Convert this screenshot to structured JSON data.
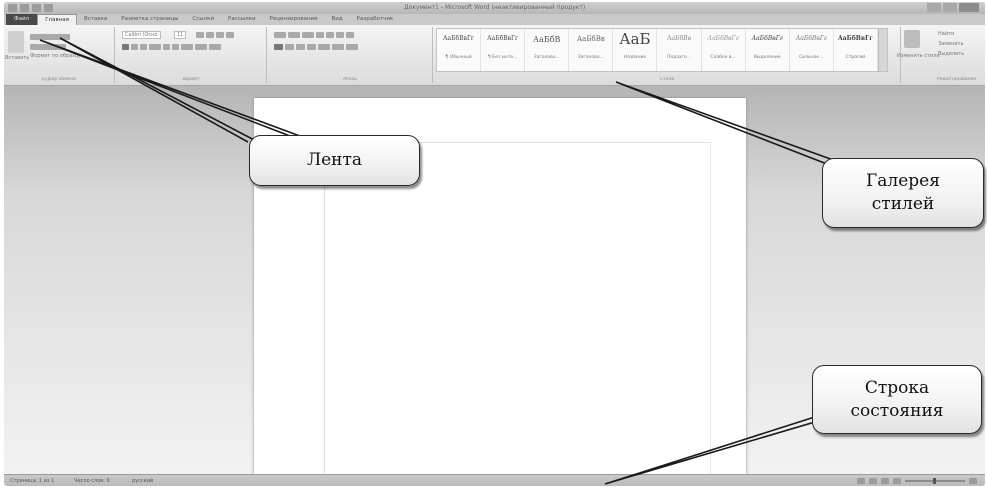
{
  "titlebar": {
    "title": "Документ1 - Microsoft Word (неактивированный продукт)"
  },
  "tabs": [
    {
      "label": "Файл"
    },
    {
      "label": "Главная"
    },
    {
      "label": "Вставка"
    },
    {
      "label": "Разметка страницы"
    },
    {
      "label": "Ссылки"
    },
    {
      "label": "Рассылки"
    },
    {
      "label": "Рецензирование"
    },
    {
      "label": "Вид"
    },
    {
      "label": "Разработчик"
    }
  ],
  "ribbon": {
    "clipboard": {
      "paste_label": "Вставить",
      "format_painter_label": "Формат по образцу",
      "group_label": "Буфер обмена"
    },
    "font": {
      "font_name": "Calibri (Осно",
      "font_size": "11",
      "group_label": "Шрифт"
    },
    "paragraph": {
      "group_label": "Абзац"
    },
    "styles": {
      "group_label": "Стили",
      "items": [
        {
          "sample": "АаБбВвГг",
          "name": "¶ Обычный"
        },
        {
          "sample": "АаБбВвГг",
          "name": "¶ Без инте..."
        },
        {
          "sample": "АаБбВ",
          "name": "Заголово..."
        },
        {
          "sample": "АаБбВв",
          "name": "Заголово..."
        },
        {
          "sample": "АаБ",
          "name": "Название"
        },
        {
          "sample": "АаБбВв",
          "name": "Подзаго..."
        },
        {
          "sample": "АаБбВвГг",
          "name": "Слабое в..."
        },
        {
          "sample": "АаБбВвГг",
          "name": "Выделение"
        },
        {
          "sample": "АаБбВвГг",
          "name": "Сильное..."
        },
        {
          "sample": "АаБбВвГг",
          "name": "Строгий"
        }
      ],
      "change_styles_label": "Изменить стили"
    },
    "editing": {
      "find_label": "Найти",
      "replace_label": "Заменить",
      "select_label": "Выделить",
      "group_label": "Редактирование"
    }
  },
  "statusbar": {
    "page": "Страница: 1 из 1",
    "words": "Число слов: 0",
    "language": "русский"
  },
  "callouts": {
    "ribbon": "Лента",
    "styles_gallery": "Галерея\nстилей",
    "status_bar": "Строка\nсостояния"
  },
  "colors": {
    "window_bg": "#d8d8d8",
    "callout_border": "#2a2a2a",
    "arrow": "#1a1a1a"
  }
}
